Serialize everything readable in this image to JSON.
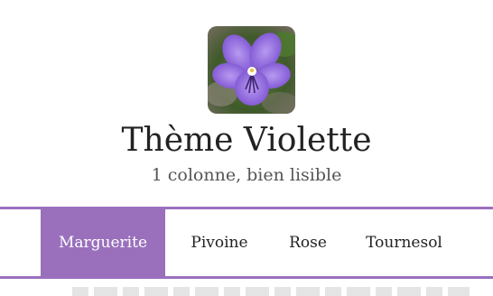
{
  "header": {
    "title": "Thème Violette",
    "subtitle": "1 colonne, bien lisible",
    "logo_icon": "violet-flower-icon"
  },
  "nav": {
    "items": [
      {
        "label": "Marguerite",
        "active": true
      },
      {
        "label": "Pivoine",
        "active": false
      },
      {
        "label": "Rose",
        "active": false
      },
      {
        "label": "Tournesol",
        "active": false
      }
    ]
  },
  "colors": {
    "accent": "#9a70bd",
    "text": "#222222",
    "subtitle": "#555555"
  }
}
